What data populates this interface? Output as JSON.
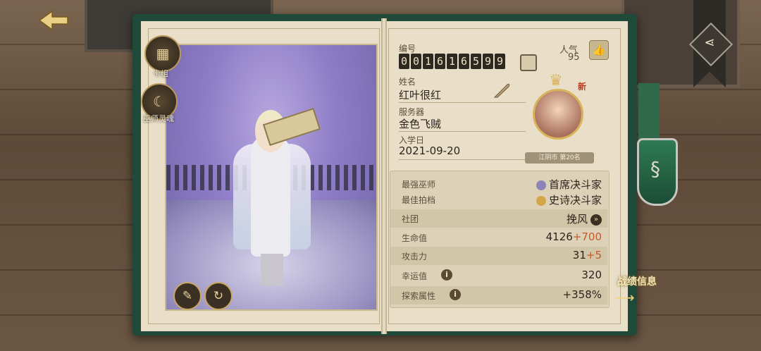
{
  "left_menu": {
    "card_group_label": "卡组",
    "wizard_soul_label": "巫师灵魂"
  },
  "profile": {
    "id_label": "编号",
    "id_digits": [
      "0",
      "0",
      "1",
      "6",
      "1",
      "6",
      "5",
      "9",
      "9"
    ],
    "name_label": "姓名",
    "name": "红叶很红",
    "server_label": "服务器",
    "server": "金色飞贼",
    "enroll_label": "入学日",
    "enroll_date": "2021-09-20",
    "popularity_label": "人气",
    "popularity_value": "95",
    "new_badge": "新",
    "rank_text": "江阴市 第20名"
  },
  "stats": {
    "strongest_wizard_label": "最强巫师",
    "strongest_wizard_value": "首席决斗家",
    "best_partner_label": "最佳拍档",
    "best_partner_value": "史诗决斗家",
    "club_label": "社团",
    "club_value": "挽风",
    "hp_label": "生命值",
    "hp_base": "4126",
    "hp_bonus": "+700",
    "atk_label": "攻击力",
    "atk_base": "31",
    "atk_bonus": "+5",
    "luck_label": "幸运值",
    "luck_value": "320",
    "explore_label": "探索属性",
    "explore_value": "+358%"
  },
  "battle_info_label": "战绩信息",
  "icons": {
    "back": "back-arrow-icon",
    "share": "share-icon",
    "like": "thumbs-up-icon",
    "copy": "copy-icon",
    "quill": "quill-icon",
    "info": "info-icon",
    "house": "slytherin-crest-icon",
    "edit": "edit-portrait-icon",
    "refresh": "refresh-icon"
  },
  "colors": {
    "book_cover": "#1f4a3a",
    "page": "#e9dfc9",
    "bonus": "#c35a28",
    "house_green": "#2f7a54"
  }
}
